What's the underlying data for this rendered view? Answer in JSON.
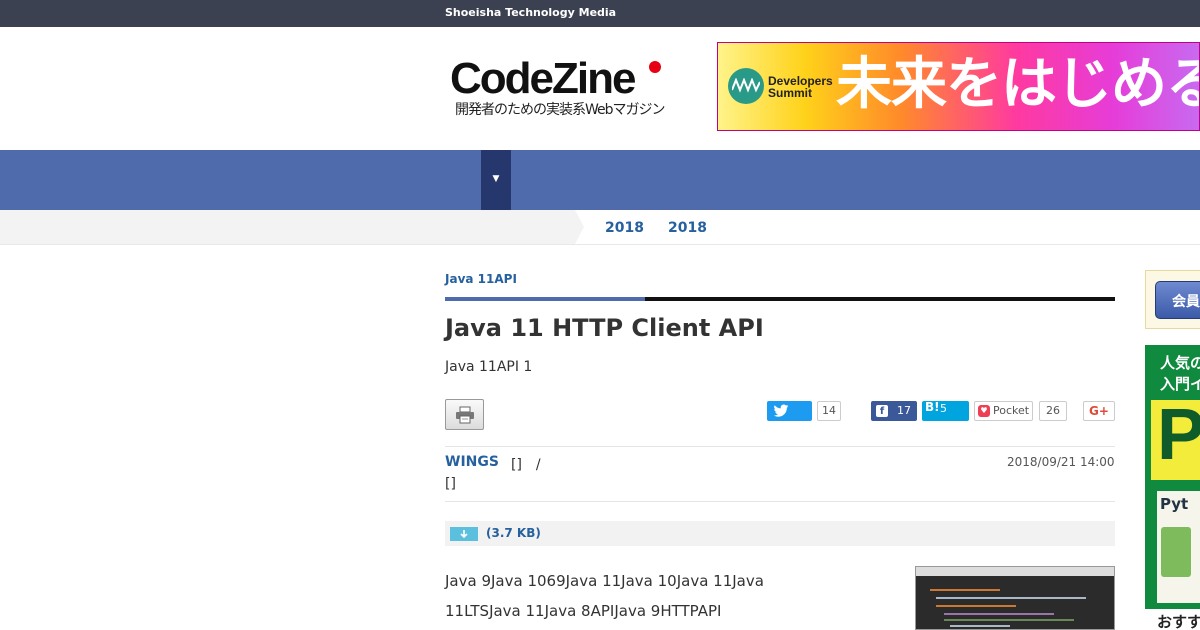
{
  "topbar": {
    "label": "Shoeisha Technology Media"
  },
  "logo": {
    "wordmark": "CodeZine",
    "tagline": "開発者のための実装系Webマガジン"
  },
  "banner": {
    "brand": [
      "Developers",
      "Summit"
    ],
    "slogan": "未来をはじめる"
  },
  "nav": {
    "dropdown_glyph": "▼"
  },
  "breadcrumb": [
    "2018",
    "2018"
  ],
  "article": {
    "category": "Java 11API",
    "title": "Java 11 HTTP Client API",
    "subtitle": "Java 11API 1",
    "author": {
      "name": "WINGS",
      "role": "[]　/",
      "extra": "[]"
    },
    "date": "2018/09/21 14:00",
    "download": {
      "label": "(3.7 KB)"
    },
    "body_lines": [
      "Java 9Java 1069Java 11Java 10Java 11Java",
      "11LTSJava 11Java 8APIJava 9HTTPAPI"
    ]
  },
  "social": {
    "twitter_count": "14",
    "facebook_count": "17",
    "hatena_label": "B!",
    "hatena_count": "5",
    "pocket_label": "Pocket",
    "pocket_count": "26",
    "gplus_label": "G+"
  },
  "sidebar": {
    "member_button": "会員",
    "ad_heading": [
      "人気の",
      "入門イ"
    ],
    "ad_big_letter": "P",
    "ad_book_title": "Pyt",
    "ad_footer": "おすす"
  },
  "colors": {
    "nav": "#4f6bab",
    "nav_dark": "#26376d",
    "link": "#26609e",
    "topbar": "#3b4150"
  }
}
